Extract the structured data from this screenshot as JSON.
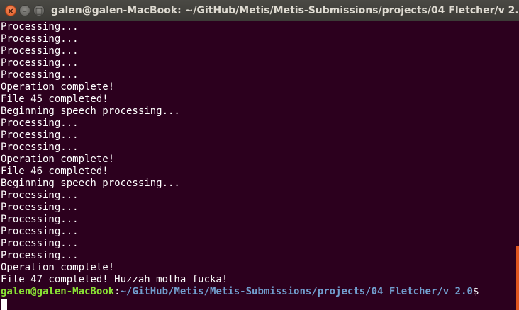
{
  "window": {
    "title": "galen@galen-MacBook: ~/GitHub/Metis/Metis-Submissions/projects/04 Fletcher/v 2.0",
    "close_glyph": "×",
    "minimize_glyph": "–",
    "maximize_glyph": "□"
  },
  "terminal": {
    "lines": [
      "Processing...",
      "Processing...",
      "Processing...",
      "Processing...",
      "Processing...",
      "Operation complete!",
      "File 45 completed!",
      "Beginning speech processing...",
      "Processing...",
      "Processing...",
      "Processing...",
      "Operation complete!",
      "File 46 completed!",
      "Beginning speech processing...",
      "Processing...",
      "Processing...",
      "Processing...",
      "Processing...",
      "Processing...",
      "Processing...",
      "Operation complete!",
      "File 47 completed! Huzzah motha fucka!"
    ],
    "prompt": {
      "user_host": "galen@galen-MacBook",
      "separator": ":",
      "path": "~/GitHub/Metis/Metis-Submissions/projects/04 Fletcher/v 2.0",
      "symbol": "$"
    }
  },
  "colors": {
    "background": "#2c001e",
    "prompt_user": "#8ae234",
    "prompt_path": "#729fcf",
    "scrollbar": "#e0561f"
  }
}
